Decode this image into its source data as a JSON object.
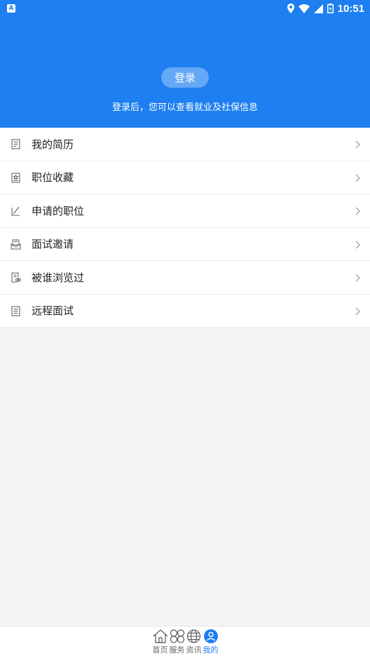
{
  "status_bar": {
    "notification_badge": "A",
    "time": "10:51"
  },
  "header": {
    "login_button": "登录",
    "hint": "登录后，您可以查看就业及社保信息",
    "color": "#1d7ff0"
  },
  "menu": {
    "items": [
      {
        "label": "我的简历",
        "icon": "resume-icon"
      },
      {
        "label": "职位收藏",
        "icon": "favorite-icon"
      },
      {
        "label": "申请的职位",
        "icon": "apply-icon"
      },
      {
        "label": "面试邀请",
        "icon": "invite-icon"
      },
      {
        "label": "被谁浏览过",
        "icon": "viewed-icon"
      },
      {
        "label": "远程面试",
        "icon": "remote-interview-icon"
      }
    ]
  },
  "bottom_nav": {
    "tabs": [
      {
        "label": "首页",
        "icon": "home-icon",
        "active": false
      },
      {
        "label": "服务",
        "icon": "services-icon",
        "active": false
      },
      {
        "label": "资讯",
        "icon": "globe-icon",
        "active": false
      },
      {
        "label": "我的",
        "icon": "user-icon",
        "active": true
      }
    ],
    "active_color": "#1d7ff0"
  }
}
